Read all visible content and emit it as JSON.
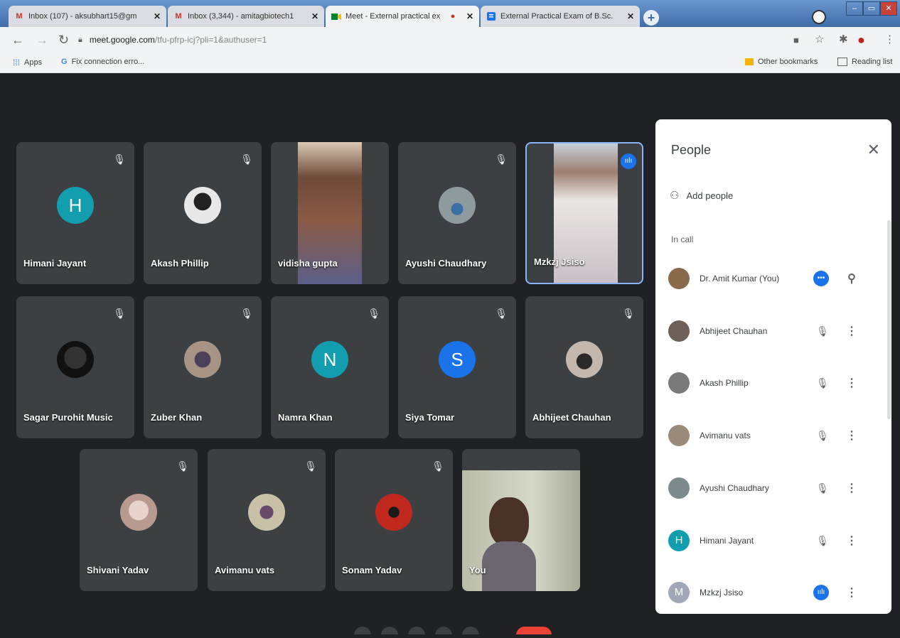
{
  "tabs": [
    {
      "title": "Inbox (107) - aksubhart15@gm",
      "favicon": "M",
      "color": "#d93025"
    },
    {
      "title": "Inbox (3,344) - amitagbiotech1",
      "favicon": "M",
      "color": "#d93025"
    },
    {
      "title": "Meet - External practical ex",
      "favicon": "meet-icon",
      "color": "#188038"
    },
    {
      "title": "External Practical Exam of B.Sc.",
      "favicon": "forms-icon",
      "color": "#1a73e8"
    }
  ],
  "address": {
    "host": "meet.google.com",
    "path": "/tfu-pfrp-icj?pli=1&authuser=1"
  },
  "bookmarks": {
    "apps": "Apps",
    "fix": "Fix connection erro...",
    "other": "Other bookmarks",
    "reading": "Reading list"
  },
  "tiles": [
    {
      "name": "Himani Jayant",
      "type": "letter",
      "letter": "H",
      "color": "#129eaf"
    },
    {
      "name": "Akash Phillip",
      "type": "photo",
      "color": "#d8d8d8"
    },
    {
      "name": "vidisha gupta",
      "type": "video",
      "color": "#8a6a58"
    },
    {
      "name": "Ayushi Chaudhary",
      "type": "photo",
      "color": "#7c8a8e"
    },
    {
      "name": "Mzkzj Jsiso",
      "type": "video",
      "color": "#b8b2b0"
    },
    {
      "name": "Sagar Purohit Music",
      "type": "photo",
      "color": "#1c1c1c"
    },
    {
      "name": "Zuber Khan",
      "type": "photo",
      "color": "#7b6c5e"
    },
    {
      "name": "Namra Khan",
      "type": "letter",
      "letter": "N",
      "color": "#129eaf"
    },
    {
      "name": "Siya Tomar",
      "type": "letter",
      "letter": "S",
      "color": "#1a73e8"
    },
    {
      "name": "Abhijeet Chauhan",
      "type": "photo",
      "color": "#9c8f86"
    },
    {
      "name": "Shivani Yadav",
      "type": "photo",
      "color": "#c9b9b2"
    },
    {
      "name": "Avimanu vats",
      "type": "photo",
      "color": "#9a8a7a"
    },
    {
      "name": "Sonam Yadav",
      "type": "photo",
      "color": "#b0302a"
    },
    {
      "name": "You",
      "type": "self",
      "color": "#c8cbb8"
    }
  ],
  "people": {
    "title": "People",
    "add": "Add people",
    "section": "In call",
    "list": [
      {
        "name": "Dr. Amit Kumar (You)",
        "avatar_color": "#8a6a4a",
        "state": "self"
      },
      {
        "name": "Abhijeet Chauhan",
        "avatar_color": "#6e6058",
        "state": "muted"
      },
      {
        "name": "Akash Phillip",
        "avatar_color": "#7a7a7a",
        "state": "muted"
      },
      {
        "name": "Avimanu vats",
        "avatar_color": "#9a8a7a",
        "state": "muted"
      },
      {
        "name": "Ayushi Chaudhary",
        "avatar_color": "#7c8a8e",
        "state": "muted"
      },
      {
        "name": "Himani Jayant",
        "avatar_color": "#129eaf",
        "state": "muted",
        "letter": "H"
      },
      {
        "name": "Mzkzj Jsiso",
        "avatar_color": "#a0a8b8",
        "state": "speaking",
        "letter": "M"
      }
    ]
  }
}
